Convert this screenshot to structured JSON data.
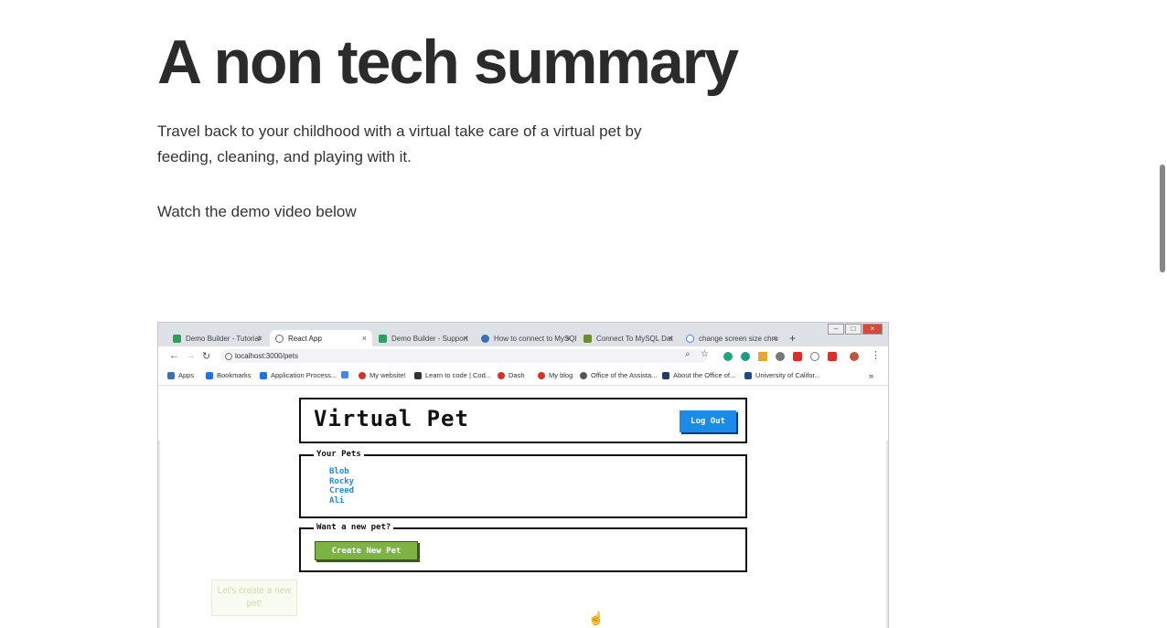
{
  "article": {
    "title": "A non tech summary",
    "intro": "Travel back to your childhood with a virtual take care of a virtual pet by feeding, cleaning, and playing with it.",
    "demo_note": "Watch the demo video below"
  },
  "browser": {
    "tabs": [
      {
        "label": "Demo Builder - Tutorial",
        "favicon_color": "#2e9e5e"
      },
      {
        "label": "React App",
        "favicon_color": "#666666"
      },
      {
        "label": "Demo Builder - Support",
        "favicon_color": "#2e9e5e"
      },
      {
        "label": "How to connect to MySQL",
        "favicon_color": "#3b6fb6"
      },
      {
        "label": "Connect To MySQL Dat",
        "favicon_color": "#6a8f2a"
      },
      {
        "label": "change screen size chro",
        "favicon_color": "#4285f4"
      }
    ],
    "address": "localhost:3000/pets",
    "bookmarks": [
      {
        "label": "Apps",
        "color": "#3b6fb6"
      },
      {
        "label": "Bookmarks",
        "color": "#1a73e8"
      },
      {
        "label": "Application Process...",
        "color": "#1a73e8"
      },
      {
        "label": "",
        "color": "#4285f4"
      },
      {
        "label": "My website!",
        "color": "#d93025"
      },
      {
        "label": "Learn to code | Cod...",
        "color": "#333333"
      },
      {
        "label": "Dash",
        "color": "#d93025"
      },
      {
        "label": "My blog",
        "color": "#d93025"
      },
      {
        "label": "Office of the Assista...",
        "color": "#555555"
      },
      {
        "label": "About the Office of...",
        "color": "#1f3b63"
      },
      {
        "label": "University of Califor...",
        "color": "#1a4e8a"
      }
    ]
  },
  "app": {
    "title": "Virtual Pet",
    "logout_label": "Log Out",
    "pets_legend": "Your Pets",
    "pets": [
      "Blob",
      "Rocky",
      "Creed",
      "Ali"
    ],
    "new_legend": "Want a new pet?",
    "create_label": "Create New Pet",
    "tooltip": "Let's create a new pet!"
  },
  "colors": {
    "accent_blue": "#1a8be8",
    "create_green": "#7cb342"
  }
}
